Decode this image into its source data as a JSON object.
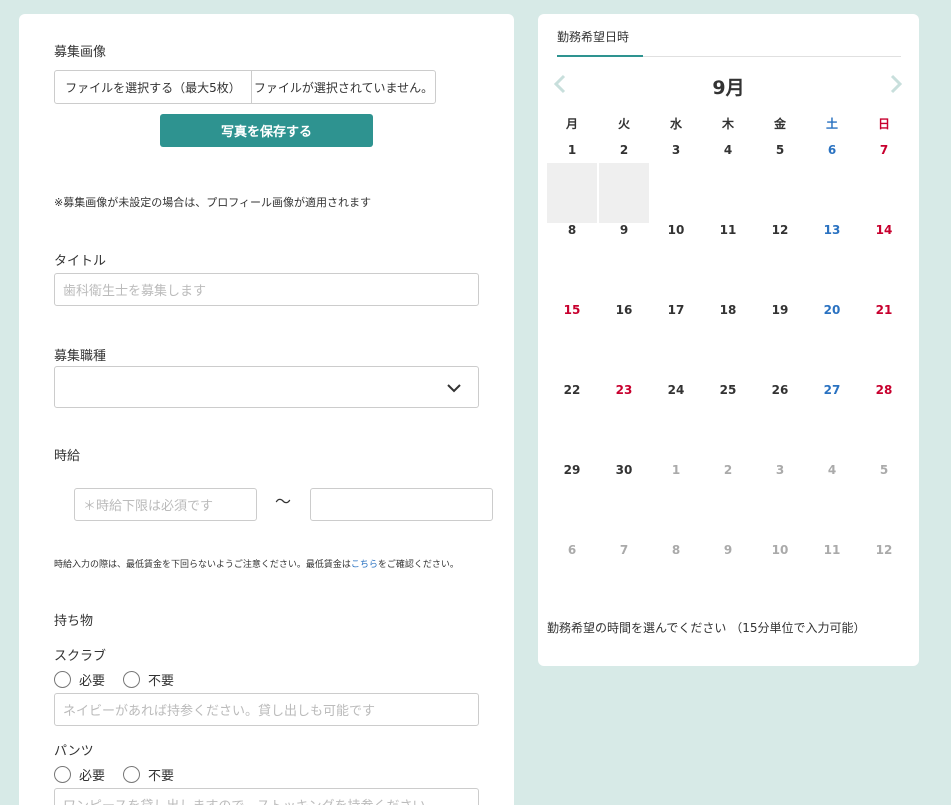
{
  "form": {
    "image_label": "募集画像",
    "file_button": "ファイルを選択する（最大5枚）",
    "file_status": "ファイルが選択されていません。",
    "save_button": "写真を保存する",
    "image_note": "※募集画像が未設定の場合は、プロフィール画像が適用されます",
    "title_label": "タイトル",
    "title_placeholder": "歯科衛生士を募集します",
    "job_label": "募集職種",
    "wage_label": "時給",
    "wage_min_placeholder": "＊時給下限は必須です",
    "wage_max_placeholder": "",
    "tilde": "〜",
    "wage_note_pre": "時給入力の際は、最低賃金を下回らないようご注意ください。最低賃金は",
    "wage_note_link": "こちら",
    "wage_note_post": "をご確認ください。",
    "belongings_label": "持ち物",
    "items": [
      {
        "name": "スクラブ",
        "options": [
          "必要",
          "不要"
        ],
        "placeholder": "ネイビーがあれば持参ください。貸し出しも可能です"
      },
      {
        "name": "パンツ",
        "options": [
          "必要",
          "不要"
        ],
        "placeholder": "ワンピースを貸し出しますので、ストッキングを持参ください"
      }
    ]
  },
  "calendar": {
    "tab": "勤務希望日時",
    "month": "9月",
    "prev_icon": "chevron-left-icon",
    "next_icon": "chevron-right-icon",
    "weekdays": [
      "月",
      "火",
      "水",
      "木",
      "金",
      "土",
      "日"
    ],
    "weeks": [
      [
        "1",
        "2",
        "3",
        "4",
        "5",
        "6",
        "7"
      ],
      [
        "8",
        "9",
        "10",
        "11",
        "12",
        "13",
        "14"
      ],
      [
        "15",
        "16",
        "17",
        "18",
        "19",
        "20",
        "21"
      ],
      [
        "22",
        "23",
        "24",
        "25",
        "26",
        "27",
        "28"
      ],
      [
        "29",
        "30",
        "1",
        "2",
        "3",
        "4",
        "5"
      ],
      [
        "6",
        "7",
        "8",
        "9",
        "10",
        "11",
        "12"
      ]
    ],
    "hint": "勤務希望の時間を選んでください （15分単位で入力可能）",
    "colors": {
      "saturday": "#2a72c1",
      "sunday_holiday": "#c8002e",
      "accent": "#2e9390"
    }
  }
}
